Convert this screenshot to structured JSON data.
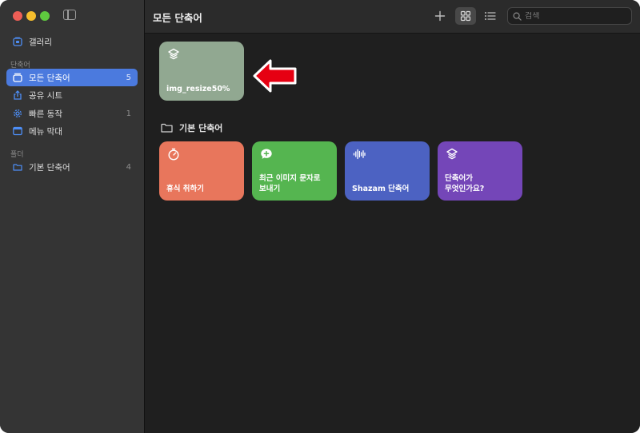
{
  "sidebar": {
    "items": [
      {
        "label": "갤러리",
        "icon": "gallery-icon",
        "count": ""
      },
      {
        "label": "모든 단축어",
        "icon": "all-shortcuts-icon",
        "count": "5",
        "active": true
      },
      {
        "label": "공유 시트",
        "icon": "share-icon",
        "count": ""
      },
      {
        "label": "빠른 동작",
        "icon": "gear-icon",
        "count": "1"
      },
      {
        "label": "메뉴 막대",
        "icon": "menubar-icon",
        "count": ""
      }
    ],
    "section_shortcuts": "단축어",
    "section_folders": "폴더",
    "folders": [
      {
        "label": "기본 단축어",
        "icon": "folder-icon",
        "count": "4"
      }
    ]
  },
  "toolbar": {
    "title": "모든 단축어",
    "search_placeholder": "검색"
  },
  "main": {
    "top_card": {
      "label": "img_resize50%",
      "icon": "layers-icon",
      "color": "#91a891"
    },
    "section_title": "기본 단축어",
    "cards": [
      {
        "label": "휴식 취하기",
        "icon": "timer-icon",
        "color": "#e8765c"
      },
      {
        "label": "최근 이미지 문자로\n보내기",
        "icon": "message-plus-icon",
        "color": "#55b550"
      },
      {
        "label": "Shazam 단축어",
        "icon": "waveform-icon",
        "color": "#4c62c2"
      },
      {
        "label": "단축어가\n무엇인가요?",
        "icon": "layers-icon",
        "color": "#7446b8"
      }
    ]
  },
  "colors": {
    "accent": "#4b7ade",
    "arrow": "#e60012"
  }
}
